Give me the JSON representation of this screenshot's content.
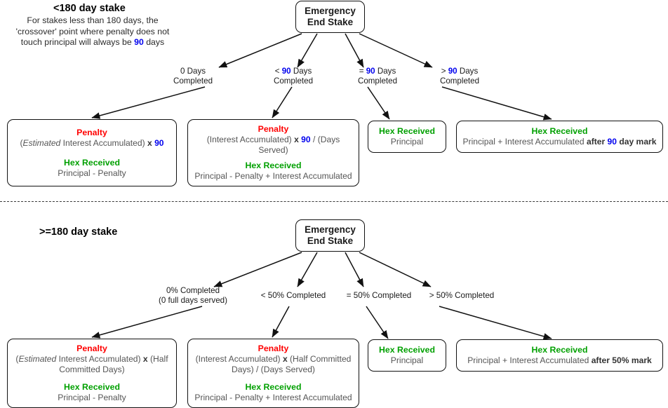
{
  "sections": [
    {
      "id": "lt180",
      "title": "<180 day stake",
      "subtitle_lines": [
        "For stakes less than 180 days, the",
        "'crossover' point where penalty does not",
        "touch principal will always be 90 days"
      ],
      "subtitle_highlight": "90",
      "root": {
        "line1": "Emergency",
        "line2": "End Stake"
      },
      "branches": [
        {
          "name": "branch-0-days",
          "label_lines": [
            "0 Days",
            "Completed"
          ],
          "highlight": ""
        },
        {
          "name": "branch-lt-90-days",
          "label_lines": [
            "< 90 Days",
            "Completed"
          ],
          "highlight": "90"
        },
        {
          "name": "branch-eq-90-days",
          "label_lines": [
            "= 90 Days",
            "Completed"
          ],
          "highlight": "90"
        },
        {
          "name": "branch-gt-90-days",
          "label_lines": [
            "> 90 Days",
            "Completed"
          ],
          "highlight": "90"
        }
      ],
      "results": [
        {
          "name": "result-0-days",
          "penalty_header": "Penalty",
          "penalty_body": "(Estimated Interest Accumulated) x 90",
          "hex_header": "Hex Received",
          "hex_body": "Principal - Penalty"
        },
        {
          "name": "result-lt-90-days",
          "penalty_header": "Penalty",
          "penalty_body": "(Interest Accumulated) x 90 / (Days Served)",
          "hex_header": "Hex Received",
          "hex_body": "Principal - Penalty + Interest Accumulated"
        },
        {
          "name": "result-eq-90-days",
          "penalty_header": "",
          "penalty_body": "",
          "hex_header": "Hex Received",
          "hex_body": "Principal"
        },
        {
          "name": "result-gt-90-days",
          "penalty_header": "",
          "penalty_body": "",
          "hex_header": "Hex Received",
          "hex_body": "Principal + Interest Accumulated after 90 day mark"
        }
      ]
    },
    {
      "id": "gte180",
      "title": ">=180 day stake",
      "subtitle_lines": [],
      "root": {
        "line1": "Emergency",
        "line2": "End Stake"
      },
      "branches": [
        {
          "name": "branch-0-percent",
          "label_lines": [
            "0% Completed",
            "(0 full days served)"
          ],
          "highlight": ""
        },
        {
          "name": "branch-lt-50-percent",
          "label_lines": [
            "< 50% Completed"
          ],
          "highlight": ""
        },
        {
          "name": "branch-eq-50-percent",
          "label_lines": [
            "= 50% Completed"
          ],
          "highlight": ""
        },
        {
          "name": "branch-gt-50-percent",
          "label_lines": [
            "> 50% Completed"
          ],
          "highlight": ""
        }
      ],
      "results": [
        {
          "name": "result-0-percent",
          "penalty_header": "Penalty",
          "penalty_body": "(Estimated Interest Accumulated) x (Half Committed Days)",
          "hex_header": "Hex Received",
          "hex_body": "Principal - Penalty"
        },
        {
          "name": "result-lt-50-percent",
          "penalty_header": "Penalty",
          "penalty_body": "(Interest Accumulated) x (Half Committed Days) / (Days Served)",
          "hex_header": "Hex Received",
          "hex_body": "Principal - Penalty + Interest Accumulated"
        },
        {
          "name": "result-eq-50-percent",
          "penalty_header": "",
          "penalty_body": "",
          "hex_header": "Hex Received",
          "hex_body": "Principal"
        },
        {
          "name": "result-gt-50-percent",
          "penalty_header": "",
          "penalty_body": "",
          "hex_header": "Hex Received",
          "hex_body": "Principal + Interest Accumulated after 50% mark"
        }
      ]
    }
  ],
  "colors": {
    "penalty": "#ff0000",
    "hex_received": "#00a000",
    "highlight": "#0000ee",
    "body_text": "#555555",
    "stroke": "#111111"
  }
}
